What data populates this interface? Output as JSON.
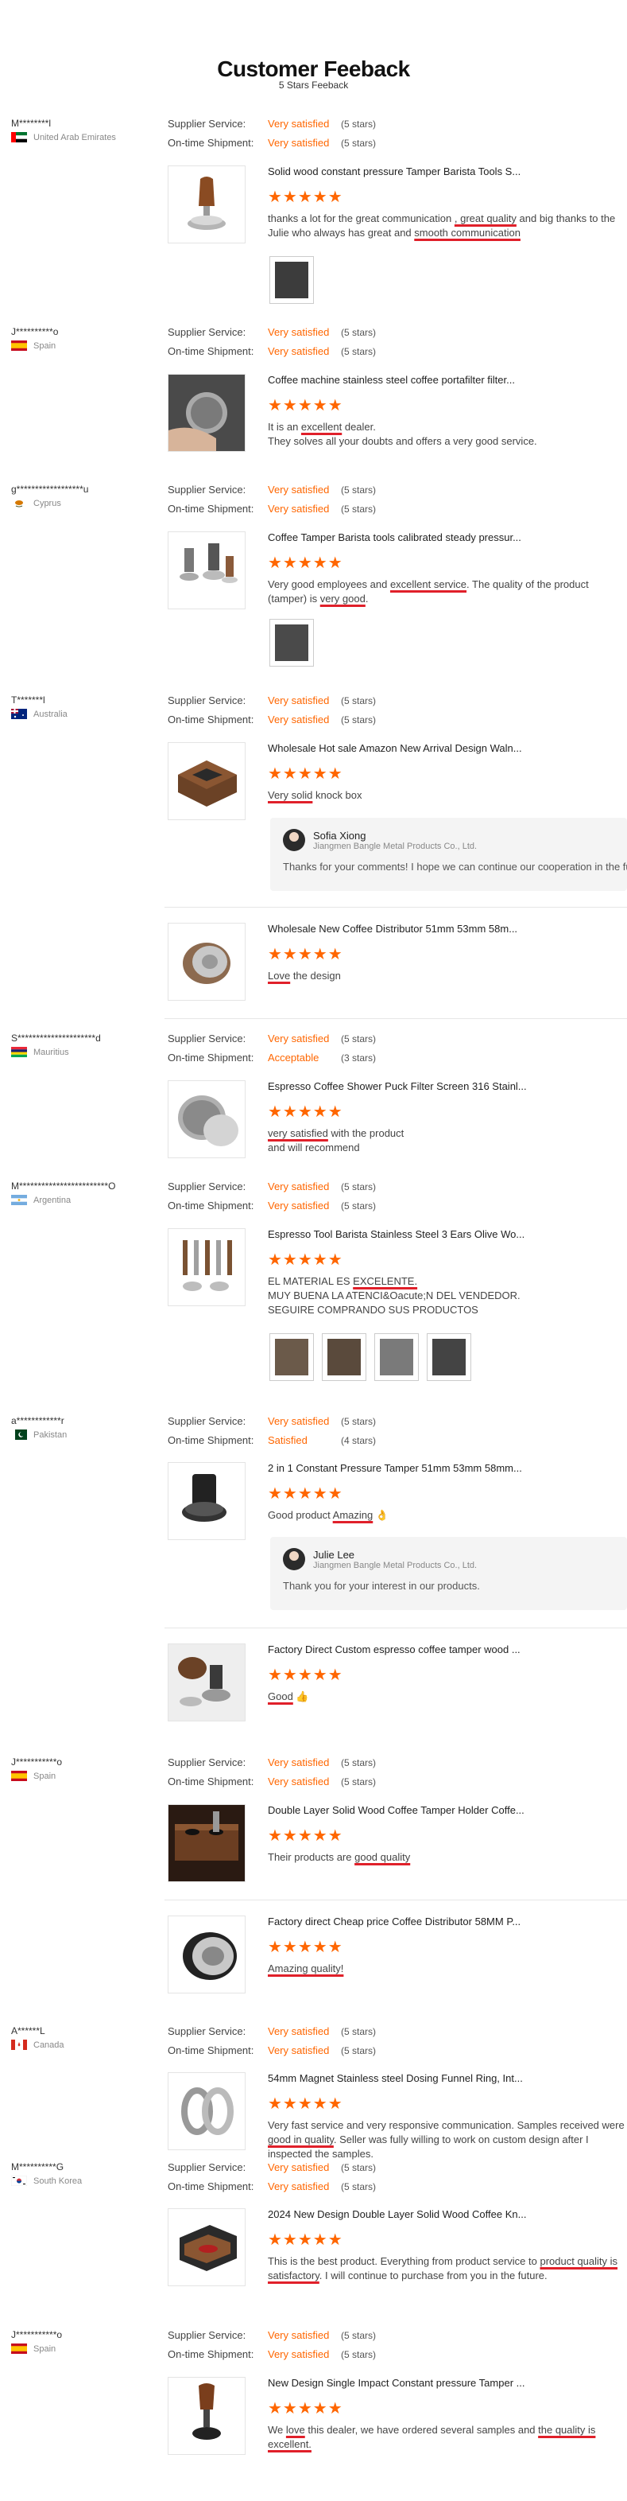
{
  "header": {
    "title": "Customer Feeback",
    "subtitle": "5 Stars Feeback"
  },
  "labels": {
    "supplier_service": "Supplier Service:",
    "ontime_shipment": "On-time Shipment:"
  },
  "stars_glyph": "★★★★★",
  "reviews": [
    {
      "buyer": "M********l",
      "country": "United Arab Emirates",
      "flag": "ae",
      "service": "Very satisfied",
      "service_stars": "(5 stars)",
      "shipment": "Very satisfied",
      "shipment_stars": "(5 stars)",
      "product": "Solid wood constant pressure Tamper Barista Tools S...",
      "text": "thanks a lot for the great communication , great quality and big thanks to the Julie who always has great and smooth communication"
    },
    {
      "buyer": "J**********o",
      "country": "Spain",
      "flag": "es",
      "service": "Very satisfied",
      "service_stars": "(5 stars)",
      "shipment": "Very satisfied",
      "shipment_stars": "(5 stars)",
      "product": "Coffee machine stainless steel coffee portafilter filter...",
      "text": "It is an excellent dealer. They solves all your doubts and offers a very good service."
    },
    {
      "buyer": "g******************u",
      "country": "Cyprus",
      "flag": "cy",
      "service": "Very satisfied",
      "service_stars": "(5 stars)",
      "shipment": "Very satisfied",
      "shipment_stars": "(5 stars)",
      "product": "Coffee Tamper Barista tools calibrated steady pressur...",
      "text": "Very good employees and excellent service. The quality of the product (tamper) is very good."
    },
    {
      "buyer": "T*******l",
      "country": "Australia",
      "flag": "au",
      "service": "Very satisfied",
      "service_stars": "(5 stars)",
      "shipment": "Very satisfied",
      "shipment_stars": "(5 stars)",
      "product": "Wholesale Hot sale Amazon New Arrival Design Waln...",
      "text": "Very solid knock box",
      "reply": {
        "name": "Sofia Xiong",
        "company": "Jiangmen Bangle Metal Products Co., Ltd.",
        "text": "Thanks for your comments! I hope we can continue our cooperation in the future"
      }
    },
    {
      "product": "Wholesale New Coffee Distributor 51mm 53mm 58m...",
      "text": "Love the design"
    },
    {
      "buyer": "S*********************d",
      "country": "Mauritius",
      "flag": "mu",
      "service": "Very satisfied",
      "service_stars": "(5 stars)",
      "shipment": "Acceptable",
      "shipment_stars": "(3 stars)",
      "product": "Espresso Coffee Shower Puck Filter Screen 316 Stainl...",
      "text": "very satisfied with the product and will recommend"
    },
    {
      "buyer": "M************************O",
      "country": "Argentina",
      "flag": "ar",
      "service": "Very satisfied",
      "service_stars": "(5 stars)",
      "shipment": "Very satisfied",
      "shipment_stars": "(5 stars)",
      "product": "Espresso Tool Barista Stainless Steel 3 Ears Olive Wo...",
      "text": "EL MATERIAL ES EXCELENTE. MUY BUENA LA ATENCI&Oacute;N DEL VENDEDOR. SEGUIRE COMPRANDO SUS PRODUCTOS"
    },
    {
      "buyer": "a************r",
      "country": "Pakistan",
      "flag": "pk",
      "service": "Very satisfied",
      "service_stars": "(5 stars)",
      "shipment": "Satisfied",
      "shipment_stars": "(4 stars)",
      "product": "2 in 1 Constant Pressure Tamper 51mm 53mm 58mm...",
      "text": "Good product Amazing 👌",
      "reply": {
        "name": "Julie Lee",
        "company": "Jiangmen Bangle Metal Products Co., Ltd.",
        "text": "Thank you for your interest in our products."
      }
    },
    {
      "product": "Factory Direct Custom espresso coffee tamper wood ...",
      "text": "Good 👍"
    },
    {
      "buyer": "J***********o",
      "country": "Spain",
      "flag": "es",
      "service": "Very satisfied",
      "service_stars": "(5 stars)",
      "shipment": "Very satisfied",
      "shipment_stars": "(5 stars)",
      "product": "Double Layer Solid Wood Coffee Tamper Holder Coffe...",
      "text": "Their products are good quality"
    },
    {
      "product": "Factory direct Cheap price Coffee Distributor 58MM P...",
      "text": "Amazing quality!"
    },
    {
      "buyer": "A******L",
      "country": "Canada",
      "flag": "ca",
      "service": "Very satisfied",
      "service_stars": "(5 stars)",
      "shipment": "Very satisfied",
      "shipment_stars": "(5 stars)",
      "product": "54mm Magnet Stainless steel Dosing Funnel Ring, Int...",
      "text": "Very fast service and very responsive communication. Samples received were good in quality. Seller was fully willing to work on custom design after I inspected the samples."
    },
    {
      "buyer": "M**********G",
      "country": "South Korea",
      "flag": "kr",
      "service": "Very satisfied",
      "service_stars": "(5 stars)",
      "shipment": "Very satisfied",
      "shipment_stars": "(5 stars)",
      "product": "2024 New Design Double Layer Solid Wood Coffee Kn...",
      "text": "This is the best product. Everything from product service to product quality is satisfactory. I will continue to purchase from you in the future."
    },
    {
      "buyer": "J***********o",
      "country": "Spain",
      "flag": "es",
      "service": "Very satisfied",
      "service_stars": "(5 stars)",
      "shipment": "Very satisfied",
      "shipment_stars": "(5 stars)",
      "product": "New Design Single Impact Constant pressure Tamper ...",
      "text": "We love this dealer, we have ordered several samples and the quality is excellent."
    }
  ],
  "colors": {
    "accent": "#ff6600",
    "underline": "#e0202a"
  }
}
